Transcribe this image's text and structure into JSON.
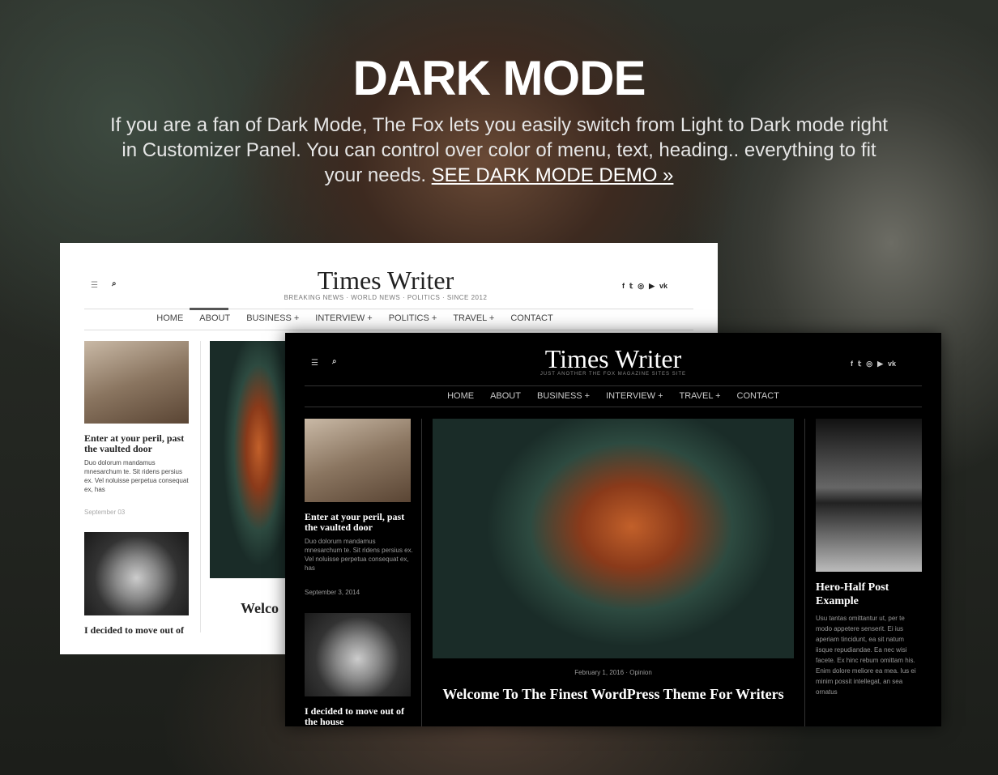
{
  "heading": "DARK MODE",
  "description": "If you are a fan of Dark Mode, The Fox lets you easily switch from Light to Dark mode right in Customizer Panel. You can control over color of menu, text, heading.. everything to fit your needs.",
  "demo_link": "SEE DARK MODE DEMO »",
  "light": {
    "logo": "Times Writer",
    "tagline": "BREAKING NEWS · WORLD NEWS · POLITICS · SINCE 2012",
    "nav": [
      "HOME",
      "ABOUT",
      "BUSINESS +",
      "INTERVIEW +",
      "POLITICS +",
      "TRAVEL +",
      "CONTACT"
    ],
    "post1_title": "Enter at your peril, past the vaulted door",
    "post1_excerpt": "Duo dolorum mandamus mnesarchum te. Sit ridens persius ex. Vel noluisse perpetua consequat ex, has",
    "post1_date": "September 03",
    "post2_title": "I decided to move out of",
    "hero_title": "Welco"
  },
  "dark": {
    "logo": "Times Writer",
    "tagline": "JUST ANOTHER THE FOX MAGAZINE SITES SITE",
    "nav": [
      "HOME",
      "ABOUT",
      "BUSINESS +",
      "INTERVIEW +",
      "TRAVEL +",
      "CONTACT"
    ],
    "post1_title": "Enter at your peril, past the vaulted door",
    "post1_excerpt": "Duo dolorum mandamus mnesarchum te. Sit ridens persius ex. Vel noluisse perpetua consequat ex, has",
    "post1_date": "September 3, 2014",
    "post2_title": "I decided to move out of the house",
    "hero_meta": "February 1, 2016  ·  Opinion",
    "hero_title": "Welcome To The Finest WordPress Theme For Writers",
    "side_title": "Hero-Half Post Example",
    "side_excerpt": "Usu tantas omittantur ut, per te modo appetere senserit. Ei ius aperiam tincidunt, ea sit natum iisque repudiandae. Ea nec wisi facete. Ex hinc rebum omittam his. Enim dolore meliore ea mea. Ius ei minim possit intellegat, an sea ornatus"
  },
  "icons": {
    "menu": "☰",
    "search": "⌕",
    "social": [
      "f",
      "𝕥",
      "◎",
      "▶",
      "vk"
    ]
  }
}
